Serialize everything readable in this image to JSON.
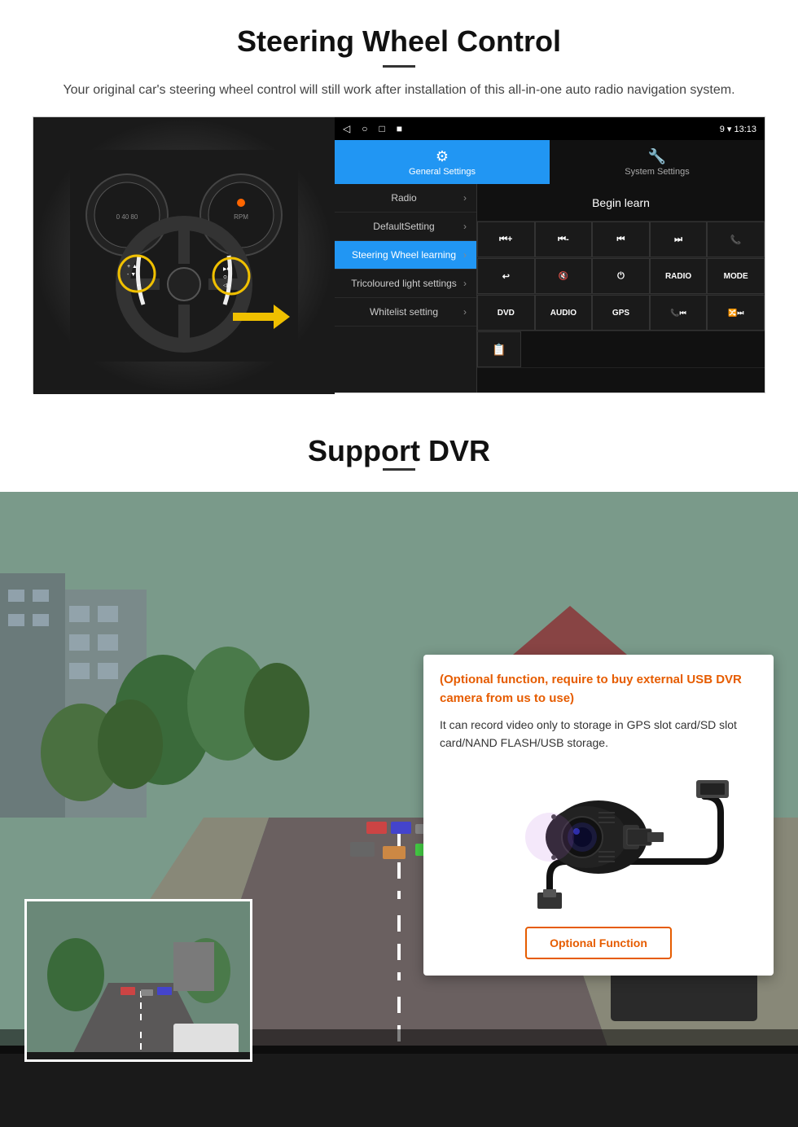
{
  "section1": {
    "title": "Steering Wheel Control",
    "description": "Your original car's steering wheel control will still work after installation of this all-in-one auto radio navigation system.",
    "topbar": {
      "nav_icons": [
        "◁",
        "○",
        "□",
        "■"
      ],
      "status": "9 ▾ 13:13"
    },
    "tabs": [
      {
        "icon": "⚙",
        "label": "General Settings",
        "active": true
      },
      {
        "icon": "🔧",
        "label": "System Settings",
        "active": false
      }
    ],
    "menu_items": [
      {
        "label": "Radio",
        "active": false
      },
      {
        "label": "DefaultSetting",
        "active": false
      },
      {
        "label": "Steering Wheel learning",
        "active": true
      },
      {
        "label": "Tricoloured light settings",
        "active": false
      },
      {
        "label": "Whitelist setting",
        "active": false
      }
    ],
    "begin_learn_label": "Begin learn",
    "control_buttons": [
      [
        "⏮+",
        "⏮-",
        "⏮⏮",
        "⏭⏭",
        "📞"
      ],
      [
        "↩",
        "🔇",
        "⏻",
        "RADIO",
        "MODE"
      ],
      [
        "DVD",
        "AUDIO",
        "GPS",
        "📞⏮",
        "🔀⏭"
      ]
    ]
  },
  "section2": {
    "title": "Support DVR",
    "optional_note": "(Optional function, require to buy external USB DVR camera from us to use)",
    "description": "It can record video only to storage in GPS slot card/SD slot card/NAND FLASH/USB storage.",
    "optional_function_btn": "Optional Function"
  }
}
